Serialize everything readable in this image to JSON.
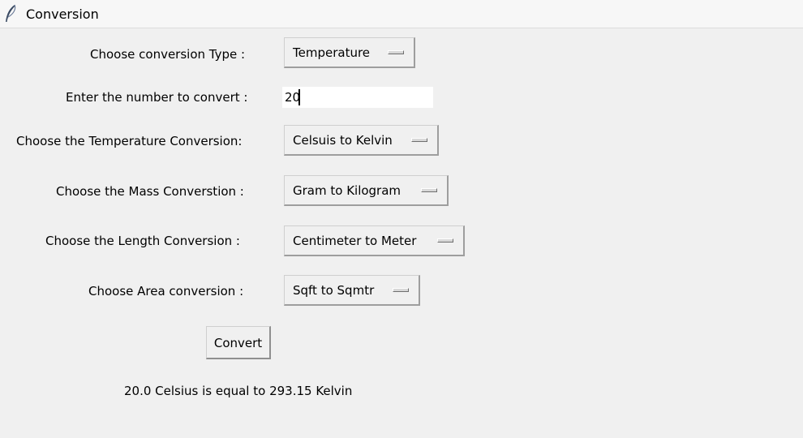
{
  "window": {
    "title": "Conversion",
    "icon": "feather-icon"
  },
  "form": {
    "type_label": "Choose conversion Type :",
    "type_value": "Temperature",
    "number_label": "Enter the number to convert :",
    "number_value": "20",
    "temperature_label": "Choose the Temperature Conversion:",
    "temperature_value": "Celsuis to Kelvin",
    "mass_label": "Choose the Mass Converstion :",
    "mass_value": "Gram to Kilogram",
    "length_label": "Choose the Length Conversion :",
    "length_value": "Centimeter to Meter",
    "area_label": "Choose Area conversion :",
    "area_value": "Sqft to Sqmtr"
  },
  "actions": {
    "convert_label": "Convert"
  },
  "output": {
    "result_text": "20.0 Celsius is equal to 293.15 Kelvin"
  }
}
